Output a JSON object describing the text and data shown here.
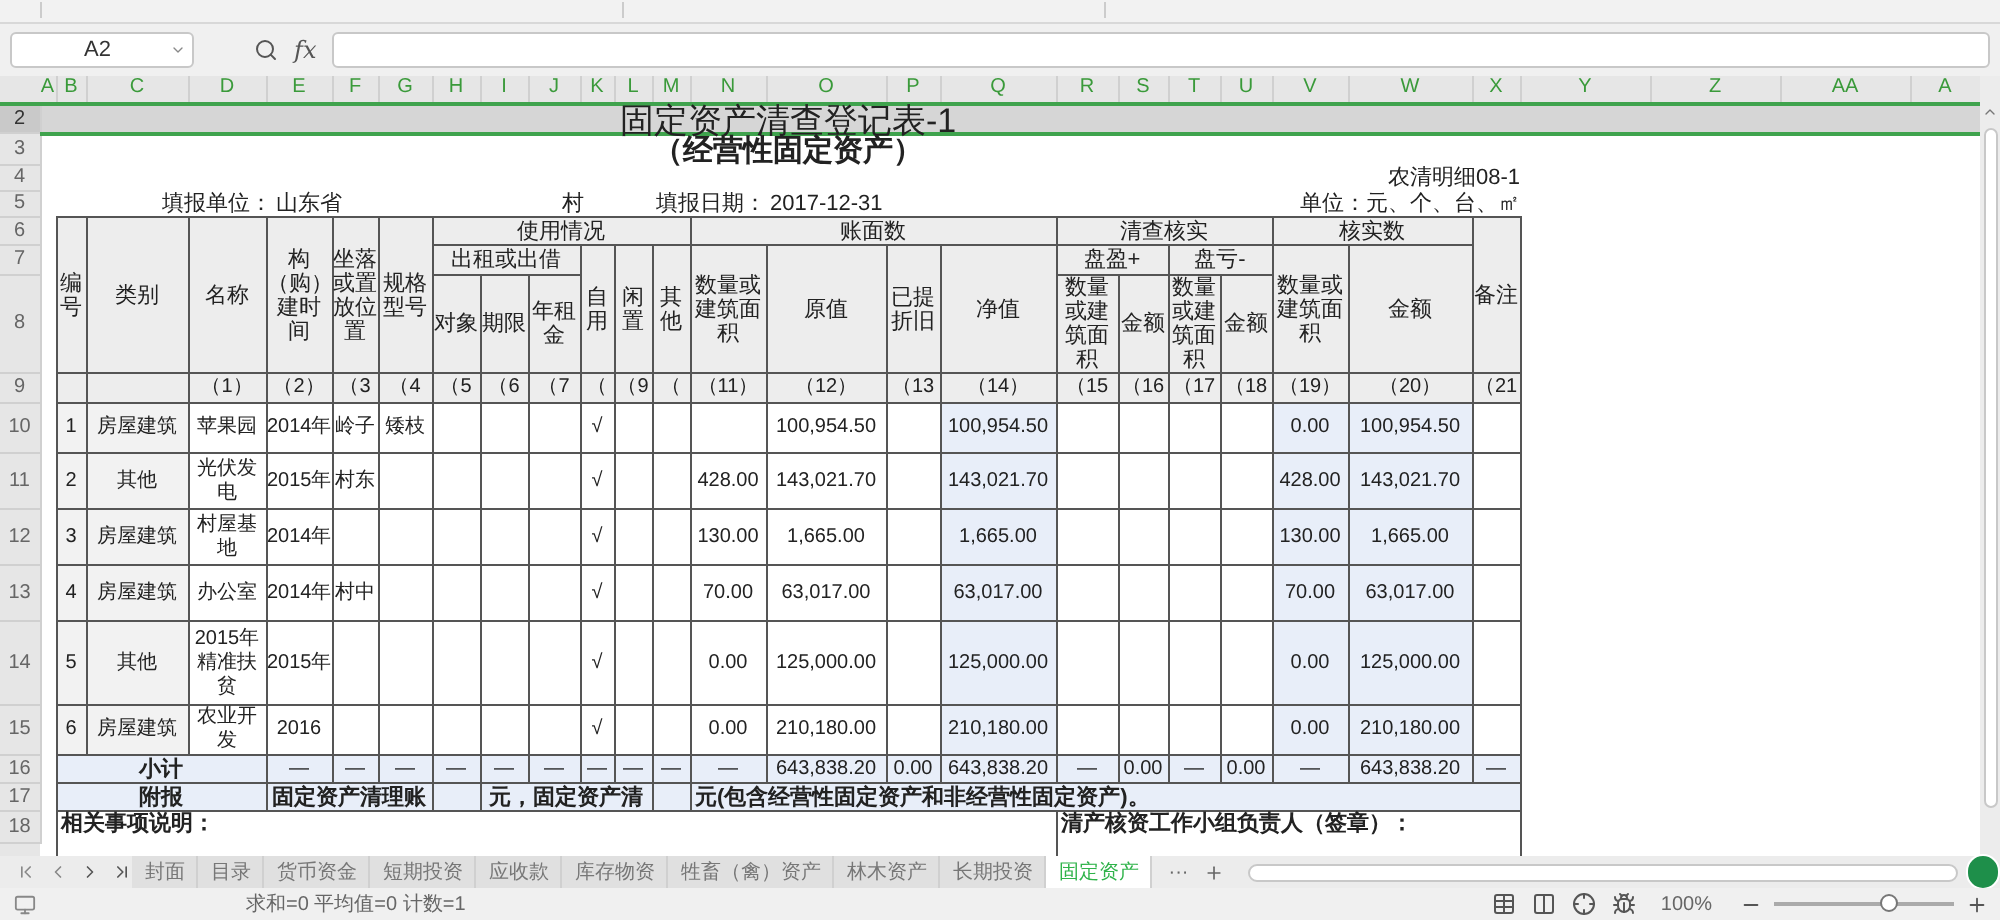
{
  "formula_bar": {
    "name_box": "A2",
    "fx": "fx"
  },
  "column_letters": [
    "A",
    "B",
    "C",
    "D",
    "E",
    "F",
    "G",
    "H",
    "I",
    "J",
    "K",
    "L",
    "M",
    "N",
    "O",
    "P",
    "Q",
    "R",
    "S",
    "T",
    "U",
    "V",
    "W",
    "X",
    "Y",
    "Z",
    "AA",
    "A"
  ],
  "row_numbers": [
    "2",
    "3",
    "4",
    "5",
    "6",
    "7",
    "8",
    "9",
    "10",
    "11",
    "12",
    "13",
    "14",
    "15",
    "16",
    "17",
    "18"
  ],
  "title": "固定资产清查登记表-1",
  "subtitle": "（经营性固定资产）",
  "form_code": "农清明细08-1",
  "fill_unit": {
    "label": "填报单位：",
    "value_start": "山东省",
    "value_end": "村"
  },
  "fill_date": {
    "label": "填报日期：",
    "value": "2017-12-31"
  },
  "unit_note": "单位：元、个、台、㎡",
  "header": {
    "no": "编号",
    "category": "类别",
    "name": "名称",
    "built": "构（购）建时间",
    "location": "坐落或置放位置",
    "spec": "规格型号",
    "usage": {
      "label": "使用情况",
      "rent": {
        "label": "出租或出借",
        "columns": [
          "对象",
          "期限",
          "年租金"
        ]
      },
      "columns": [
        "自用",
        "闲置",
        "其他"
      ]
    },
    "book": {
      "label": "账面数",
      "columns": [
        "数量或建筑面积",
        "原值",
        "已提折旧",
        "净值"
      ]
    },
    "check": {
      "label": "清查核实",
      "groups": [
        {
          "label": "盘盈+",
          "columns": [
            "数量或建筑面积",
            "金额"
          ]
        },
        {
          "label": "盘亏-",
          "columns": [
            "数量或建筑面积",
            "金额"
          ]
        }
      ]
    },
    "verified": {
      "label": "核实数",
      "columns": [
        "数量或建筑面积",
        "金额"
      ]
    },
    "remark": "备注"
  },
  "index_row": {
    "name": "（1）",
    "built": "（2）",
    "location": "（3",
    "spec": "（4",
    "rent_target": "（5",
    "rent_term": "（6",
    "rent_annual": "（7",
    "self_use": "（",
    "idle": "（9",
    "other": "（",
    "book_qty": "（11）",
    "book_original": "（12）",
    "book_depreciation": "（13",
    "book_net": "（14）",
    "surplus_qty": "（15",
    "surplus_amount": "（16",
    "loss_qty": "（17",
    "loss_amount": "（18",
    "verified_qty": "（19）",
    "verified_amount": "（20）",
    "remark": "（21"
  },
  "rows": [
    {
      "no": "1",
      "category": "房屋建筑",
      "name": "苹果园",
      "built": "2014年",
      "location": "岭子",
      "spec": "矮枝",
      "self_use": "√",
      "book_original": "100,954.50",
      "book_net": "100,954.50",
      "verified_qty": "0.00",
      "verified_amount": "100,954.50"
    },
    {
      "no": "2",
      "category": "其他",
      "name": "光伏发电",
      "built": "2015年",
      "location": "村东",
      "self_use": "√",
      "book_qty": "428.00",
      "book_original": "143,021.70",
      "book_net": "143,021.70",
      "verified_qty": "428.00",
      "verified_amount": "143,021.70"
    },
    {
      "no": "3",
      "category": "房屋建筑",
      "name": "村屋基地",
      "built": "2014年",
      "self_use": "√",
      "book_qty": "130.00",
      "book_original": "1,665.00",
      "book_net": "1,665.00",
      "verified_qty": "130.00",
      "verified_amount": "1,665.00"
    },
    {
      "no": "4",
      "category": "房屋建筑",
      "name": "办公室",
      "built": "2014年",
      "location": "村中",
      "self_use": "√",
      "book_qty": "70.00",
      "book_original": "63,017.00",
      "book_net": "63,017.00",
      "verified_qty": "70.00",
      "verified_amount": "63,017.00"
    },
    {
      "no": "5",
      "category": "其他",
      "name": "2015年精准扶贫",
      "built": "2015年",
      "self_use": "√",
      "book_qty": "0.00",
      "book_original": "125,000.00",
      "book_net": "125,000.00",
      "verified_qty": "0.00",
      "verified_amount": "125,000.00"
    },
    {
      "no": "6",
      "category": "房屋建筑",
      "name": "农业开发",
      "built": "2016",
      "self_use": "√",
      "book_qty": "0.00",
      "book_original": "210,180.00",
      "book_net": "210,180.00",
      "verified_qty": "0.00",
      "verified_amount": "210,180.00"
    }
  ],
  "subtotal": {
    "label": "小计",
    "cells": {
      "built": "—",
      "location": "—",
      "spec": "—",
      "rent_target": "—",
      "rent_term": "—",
      "rent_annual": "—",
      "self_use": "—",
      "idle": "—",
      "other": "—",
      "book_qty": "—",
      "book_original": "643,838.20",
      "book_depreciation": "0.00",
      "book_net": "643,838.20",
      "surplus_qty": "—",
      "surplus_amount": "0.00",
      "loss_qty": "—",
      "loss_amount": "0.00",
      "verified_qty": "—",
      "verified_amount": "643,838.20",
      "remark": "—"
    }
  },
  "appendix": {
    "label": "附报",
    "parts": [
      "固定资产清理账",
      "元，固定资产清",
      "元(包含经营性固定资产和非经营性固定资产)。"
    ]
  },
  "notes": {
    "left": "相关事项说明：",
    "right": "清产核资工作小组负责人（签章）："
  },
  "sheet_tabs": [
    {
      "label": "封面",
      "selected": false
    },
    {
      "label": "目录",
      "selected": false
    },
    {
      "label": "货币资金",
      "selected": false
    },
    {
      "label": "短期投资",
      "selected": false
    },
    {
      "label": "应收款",
      "selected": false
    },
    {
      "label": "库存物资",
      "selected": false
    },
    {
      "label": "牲畜（禽）资产",
      "selected": false
    },
    {
      "label": "林木资产",
      "selected": false
    },
    {
      "label": "长期投资",
      "selected": false
    },
    {
      "label": "固定资产",
      "selected": true
    }
  ],
  "more_tabs": "···",
  "status_bar": {
    "summary": "求和=0 平均值=0 计数=1",
    "zoom": "100%",
    "zoom_slider": {
      "level": 0.63
    }
  }
}
